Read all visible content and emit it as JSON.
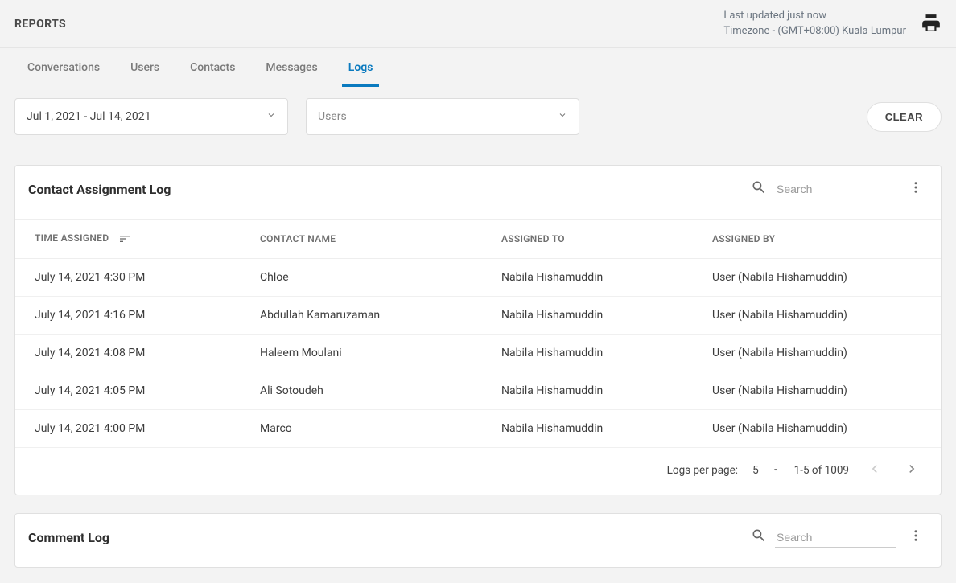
{
  "header": {
    "title": "REPORTS",
    "last_updated": "Last updated just now",
    "timezone": "Timezone - (GMT+08:00) Kuala Lumpur"
  },
  "tabs": [
    {
      "label": "Conversations",
      "active": false
    },
    {
      "label": "Users",
      "active": false
    },
    {
      "label": "Contacts",
      "active": false
    },
    {
      "label": "Messages",
      "active": false
    },
    {
      "label": "Logs",
      "active": true
    }
  ],
  "filters": {
    "date_range": "Jul 1, 2021 - Jul 14, 2021",
    "users_placeholder": "Users",
    "clear_label": "CLEAR"
  },
  "log_card": {
    "title": "Contact Assignment Log",
    "search_placeholder": "Search",
    "columns": {
      "time": "TIME ASSIGNED",
      "contact": "CONTACT NAME",
      "to": "ASSIGNED TO",
      "by": "ASSIGNED BY"
    },
    "rows": [
      {
        "time": "July 14, 2021 4:30 PM",
        "contact": "Chloe",
        "to": "Nabila Hishamuddin",
        "by": "User (Nabila Hishamuddin)"
      },
      {
        "time": "July 14, 2021 4:16 PM",
        "contact": "Abdullah Kamaruzaman",
        "to": "Nabila Hishamuddin",
        "by": "User (Nabila Hishamuddin)"
      },
      {
        "time": "July 14, 2021 4:08 PM",
        "contact": "Haleem Moulani",
        "to": "Nabila Hishamuddin",
        "by": "User (Nabila Hishamuddin)"
      },
      {
        "time": "July 14, 2021 4:05 PM",
        "contact": "Ali Sotoudeh",
        "to": "Nabila Hishamuddin",
        "by": "User (Nabila Hishamuddin)"
      },
      {
        "time": "July 14, 2021 4:00 PM",
        "contact": "Marco",
        "to": "Nabila Hishamuddin",
        "by": "User (Nabila Hishamuddin)"
      }
    ],
    "pagination": {
      "per_page_label": "Logs per page:",
      "per_page_value": "5",
      "range": "1-5 of 1009"
    }
  },
  "comment_card": {
    "title": "Comment Log",
    "search_placeholder": "Search"
  }
}
